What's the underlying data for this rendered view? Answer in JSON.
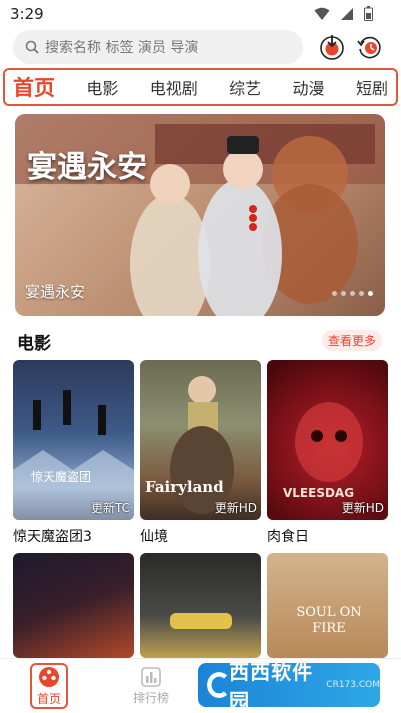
{
  "status_bar": {
    "time": "3:29"
  },
  "search": {
    "placeholder": "搜索名称 标签 演员 导演"
  },
  "tabs": [
    {
      "label": "首页",
      "active": true
    },
    {
      "label": "电影"
    },
    {
      "label": "电视剧"
    },
    {
      "label": "综艺"
    },
    {
      "label": "动漫"
    },
    {
      "label": "短剧"
    }
  ],
  "banner": {
    "title": "宴遇永安",
    "art_text": "宴遇永安"
  },
  "movie_section": {
    "title": "电影",
    "more_label": "查看更多",
    "items": [
      {
        "title": "惊天魔盗团3",
        "tag": "更新TC",
        "poster_text": "惊天魔盗团"
      },
      {
        "title": "仙境",
        "tag": "更新HD",
        "poster_text": "Fairyland"
      },
      {
        "title": "肉食日",
        "tag": "更新HD",
        "poster_text": "VLEESDAG"
      },
      {
        "title": "",
        "tag": "",
        "poster_text": ""
      },
      {
        "title": "",
        "tag": "",
        "poster_text": ""
      },
      {
        "title": "",
        "tag": "",
        "poster_text": "SOUL ON FIRE"
      }
    ]
  },
  "bottom_nav": [
    {
      "label": "首页",
      "active": true
    },
    {
      "label": "排行榜"
    }
  ],
  "watermark": {
    "main": "西西软件园",
    "sub": "CR173.COM"
  },
  "colors": {
    "accent": "#e8462b",
    "border_highlight": "#e2563a"
  }
}
